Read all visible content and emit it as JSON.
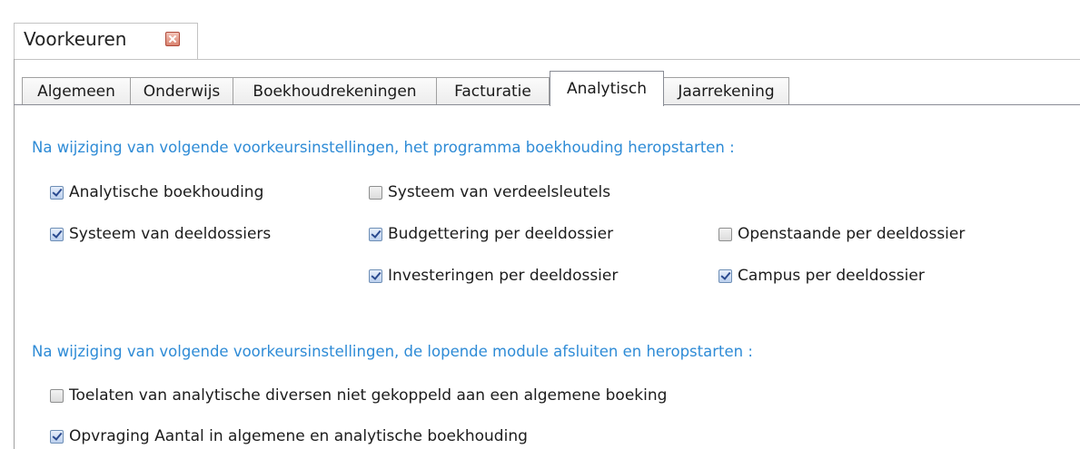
{
  "document_tab": {
    "title": "Voorkeuren"
  },
  "tabs": [
    {
      "label": "Algemeen",
      "active": false
    },
    {
      "label": "Onderwijs",
      "active": false
    },
    {
      "label": "Boekhoudrekeningen",
      "active": false
    },
    {
      "label": "Facturatie",
      "active": false
    },
    {
      "label": "Analytisch",
      "active": true
    },
    {
      "label": "Jaarrekening",
      "active": false
    }
  ],
  "section1": {
    "heading": "Na wijziging van volgende voorkeursinstellingen, het programma boekhouding heropstarten :",
    "options": [
      {
        "label": "Analytische boekhouding",
        "checked": true
      },
      {
        "label": "Systeem van verdeelsleutels",
        "checked": false
      },
      {
        "label": "Systeem van deeldossiers",
        "checked": true
      },
      {
        "label": "Budgettering per deeldossier",
        "checked": true
      },
      {
        "label": "Openstaande per deeldossier",
        "checked": false
      },
      {
        "label": "Investeringen per deeldossier",
        "checked": true
      },
      {
        "label": "Campus per deeldossier",
        "checked": true
      }
    ]
  },
  "section2": {
    "heading": "Na wijziging van volgende voorkeursinstellingen, de lopende module afsluiten en heropstarten :",
    "options": [
      {
        "label": "Toelaten van analytische diversen niet gekoppeld aan een algemene boeking",
        "checked": false
      },
      {
        "label": "Opvraging Aantal in algemene en analytische boekhouding",
        "checked": true
      }
    ]
  },
  "colors": {
    "heading": "#2e8bd6",
    "checkmark": "#2a4a8f"
  }
}
